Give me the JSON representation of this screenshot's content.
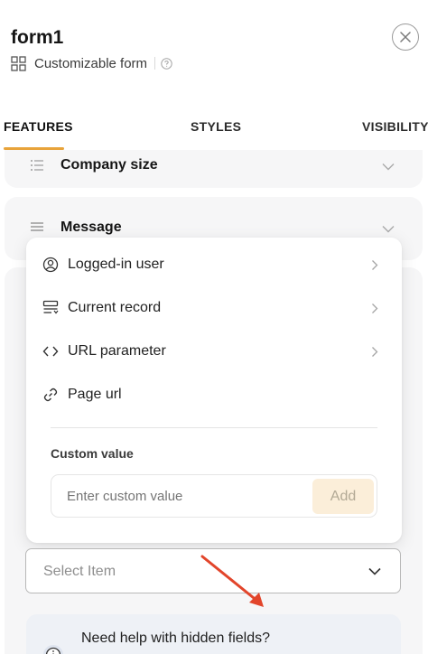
{
  "header": {
    "title": "form1",
    "subtitle": "Customizable form",
    "subtitle_icon": "grid-icon",
    "help_icon": "question-circle-icon",
    "close_icon": "close-icon"
  },
  "tabs": [
    {
      "label": "FEATURES",
      "active": true
    },
    {
      "label": "STYLES",
      "active": false
    },
    {
      "label": "VISIBILITY",
      "active": false
    }
  ],
  "fields": {
    "company_size": {
      "label": "Company size",
      "icon": "list-icon"
    },
    "message": {
      "label": "Message",
      "icon": "text-lines-icon"
    }
  },
  "dropdown": {
    "items": [
      {
        "label": "Logged-in user",
        "icon": "user-circle-icon",
        "has_submenu": true
      },
      {
        "label": "Current record",
        "icon": "record-icon",
        "has_submenu": true
      },
      {
        "label": "URL parameter",
        "icon": "code-icon",
        "has_submenu": true
      },
      {
        "label": "Page url",
        "icon": "link-icon",
        "has_submenu": false
      }
    ],
    "custom_value_label": "Custom value",
    "custom_value_placeholder": "Enter custom value",
    "add_button_label": "Add"
  },
  "select": {
    "placeholder": "Select Item"
  },
  "help": {
    "text": "Need help with hidden fields?",
    "icon": "info-icon"
  },
  "colors": {
    "accent": "#e8a33a",
    "add_button_bg": "#fbeed9",
    "annotation_arrow": "#e2452b"
  }
}
